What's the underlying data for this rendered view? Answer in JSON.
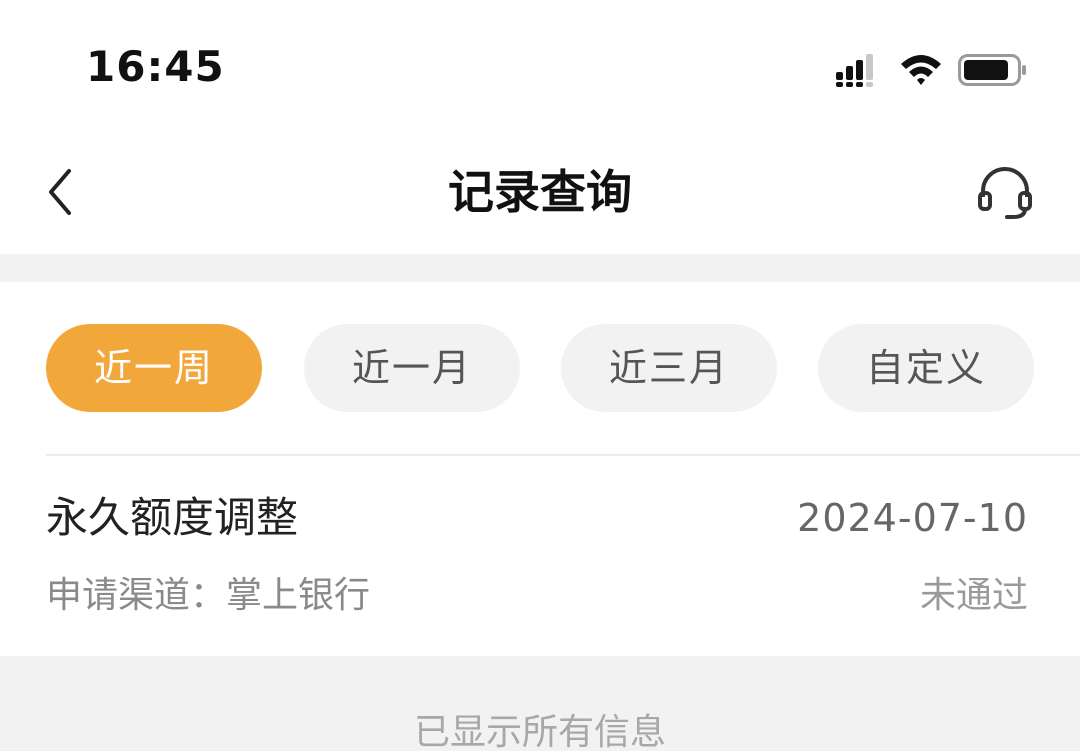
{
  "status_bar": {
    "time": "16:45",
    "icons": [
      "signal-icon",
      "wifi-icon",
      "battery-icon"
    ]
  },
  "nav": {
    "back_icon": "chevron-left-icon",
    "title": "记录查询",
    "service_icon": "headset-icon"
  },
  "filters": [
    {
      "label": "近一周",
      "active": true
    },
    {
      "label": "近一月",
      "active": false
    },
    {
      "label": "近三月",
      "active": false
    },
    {
      "label": "自定义",
      "active": false
    }
  ],
  "records": [
    {
      "title": "永久额度调整",
      "date": "2024-07-10",
      "channel": "申请渠道：掌上银行",
      "status": "未通过"
    }
  ],
  "footer": {
    "note": "已显示所有信息"
  },
  "colors": {
    "accent": "#f2a73b",
    "background": "#f2f2f2",
    "card": "#ffffff"
  }
}
